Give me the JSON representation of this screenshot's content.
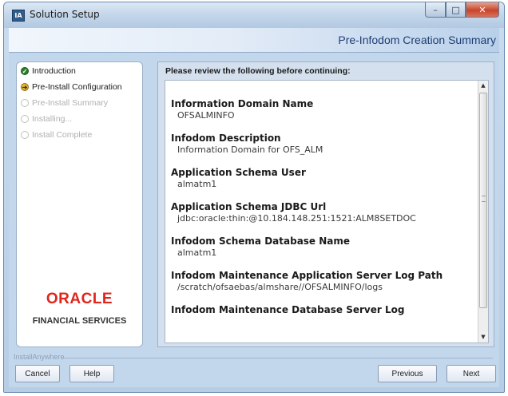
{
  "window": {
    "title": "Solution Setup",
    "icon_label": "IA",
    "controls": {
      "minimize": "–",
      "maximize": "□",
      "close": "✕"
    }
  },
  "header": {
    "title": "Pre-Infodom Creation Summary"
  },
  "steps": [
    {
      "label": "Introduction",
      "state": "done"
    },
    {
      "label": "Pre-Install Configuration",
      "state": "current"
    },
    {
      "label": "Pre-Install Summary",
      "state": "todo"
    },
    {
      "label": "Installing...",
      "state": "todo"
    },
    {
      "label": "Install Complete",
      "state": "todo"
    }
  ],
  "branding": {
    "logo": "ORACLE",
    "sub": "FINANCIAL SERVICES"
  },
  "review": {
    "heading": "Please review the following before continuing:",
    "items": [
      {
        "label": "Information Domain Name",
        "value": "OFSALMINFO"
      },
      {
        "label": "Infodom Description",
        "value": "Information Domain for OFS_ALM"
      },
      {
        "label": "Application Schema User",
        "value": "almatm1"
      },
      {
        "label": "Application Schema JDBC Url",
        "value": "jdbc:oracle:thin:@10.184.148.251:1521:ALM8SETDOC"
      },
      {
        "label": "Infodom Schema Database Name",
        "value": "almatm1"
      },
      {
        "label": "Infodom Maintenance Application Server Log Path",
        "value": "/scratch/ofsaebas/almshare//OFSALMINFO/logs"
      },
      {
        "label": "Infodom Maintenance Database Server Log",
        "value": ""
      }
    ]
  },
  "footer": {
    "brand": "InstallAnywhere",
    "cancel": "Cancel",
    "help": "Help",
    "previous": "Previous",
    "next": "Next"
  },
  "colors": {
    "accent": "#1e3e74",
    "oracle_red": "#e0261c",
    "step_done": "#2c7d2c",
    "step_current": "#e7b82b"
  }
}
